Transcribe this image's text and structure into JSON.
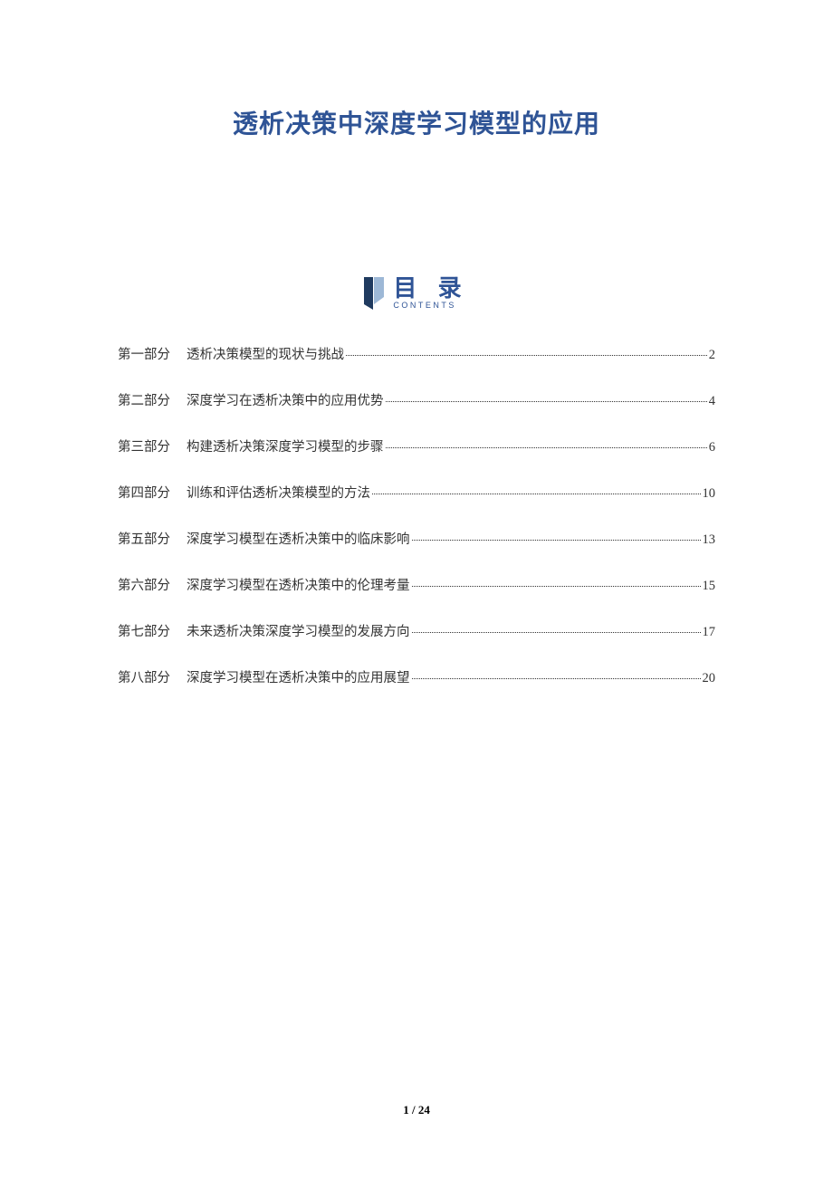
{
  "title": "透析决策中深度学习模型的应用",
  "toc_header": {
    "label": "目 录",
    "sublabel": "CONTENTS"
  },
  "toc": [
    {
      "part": "第一部分",
      "title": "透析决策模型的现状与挑战",
      "page": "2"
    },
    {
      "part": "第二部分",
      "title": "深度学习在透析决策中的应用优势",
      "page": "4"
    },
    {
      "part": "第三部分",
      "title": "构建透析决策深度学习模型的步骤",
      "page": "6"
    },
    {
      "part": "第四部分",
      "title": "训练和评估透析决策模型的方法",
      "page": "10"
    },
    {
      "part": "第五部分",
      "title": "深度学习模型在透析决策中的临床影响",
      "page": "13"
    },
    {
      "part": "第六部分",
      "title": "深度学习模型在透析决策中的伦理考量",
      "page": "15"
    },
    {
      "part": "第七部分",
      "title": "未来透析决策深度学习模型的发展方向",
      "page": "17"
    },
    {
      "part": "第八部分",
      "title": "深度学习模型在透析决策中的应用展望",
      "page": "20"
    }
  ],
  "footer": {
    "current": "1",
    "sep": " / ",
    "total": "24"
  }
}
